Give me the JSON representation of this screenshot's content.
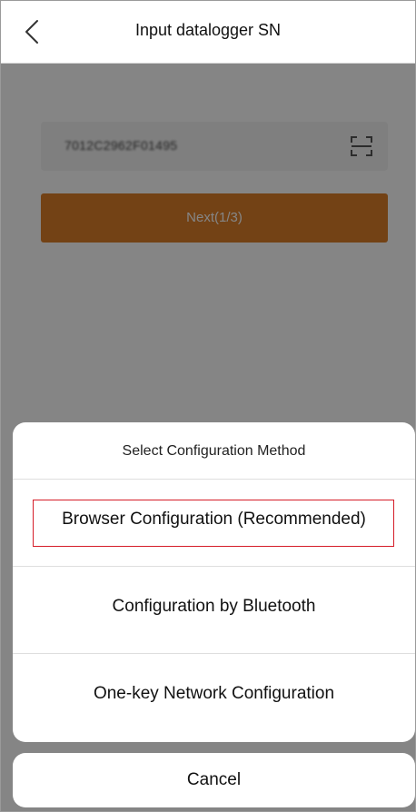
{
  "nav": {
    "title": "Input datalogger SN",
    "back_icon": "chevron-left-icon"
  },
  "form": {
    "sn_value": "7012C2962F01495",
    "scan_icon": "scan-icon",
    "next_label": "Next(1/3)"
  },
  "sheet": {
    "title": "Select Configuration Method",
    "options": [
      {
        "label": "Browser Configuration (Recommended)",
        "highlighted": true
      },
      {
        "label": "Configuration by Bluetooth"
      },
      {
        "label": "One-key Network Configuration"
      }
    ],
    "cancel_label": "Cancel"
  },
  "colors": {
    "accent": "#dc7f2a",
    "highlight_border": "#d51c28",
    "overlay": "rgba(0,0,0,0.48)"
  }
}
